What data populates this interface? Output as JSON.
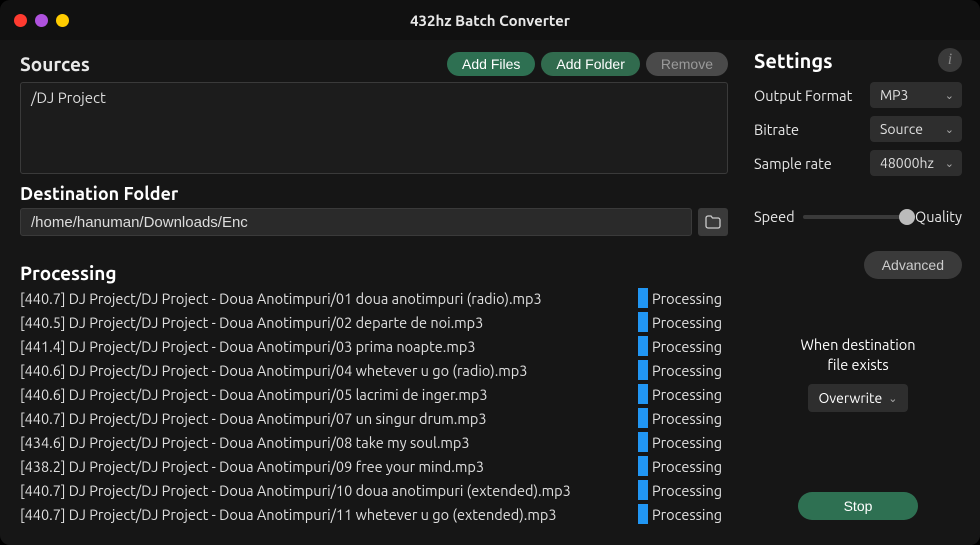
{
  "window": {
    "title": "432hz Batch Converter"
  },
  "sources": {
    "label": "Sources",
    "buttons": {
      "add_files": "Add Files",
      "add_folder": "Add Folder",
      "remove": "Remove"
    },
    "items": [
      "/DJ Project"
    ]
  },
  "destination": {
    "label": "Destination Folder",
    "path": "/home/hanuman/Downloads/Enc"
  },
  "processing": {
    "label": "Processing",
    "status_text": "Processing",
    "items": [
      {
        "hz": "440.7",
        "name": "DJ Project/DJ Project - Doua Anotimpuri/01 doua anotimpuri (radio).mp3"
      },
      {
        "hz": "440.5",
        "name": "DJ Project/DJ Project - Doua Anotimpuri/02 departe de noi.mp3"
      },
      {
        "hz": "441.4",
        "name": "DJ Project/DJ Project - Doua Anotimpuri/03 prima noapte.mp3"
      },
      {
        "hz": "440.6",
        "name": "DJ Project/DJ Project - Doua Anotimpuri/04 whetever u go (radio).mp3"
      },
      {
        "hz": "440.6",
        "name": "DJ Project/DJ Project - Doua Anotimpuri/05 lacrimi de inger.mp3"
      },
      {
        "hz": "440.7",
        "name": "DJ Project/DJ Project - Doua Anotimpuri/07 un singur drum.mp3"
      },
      {
        "hz": "434.6",
        "name": "DJ Project/DJ Project - Doua Anotimpuri/08 take my soul.mp3"
      },
      {
        "hz": "438.2",
        "name": "DJ Project/DJ Project - Doua Anotimpuri/09 free your mind.mp3"
      },
      {
        "hz": "440.7",
        "name": "DJ Project/DJ Project - Doua Anotimpuri/10 doua anotimpuri (extended).mp3"
      },
      {
        "hz": "440.7",
        "name": "DJ Project/DJ Project - Doua Anotimpuri/11 whetever u go (extended).mp3"
      }
    ]
  },
  "settings": {
    "title": "Settings",
    "output_format": {
      "label": "Output Format",
      "value": "MP3"
    },
    "bitrate": {
      "label": "Bitrate",
      "value": "Source"
    },
    "sample_rate": {
      "label": "Sample rate",
      "value": "48000hz"
    },
    "speed": {
      "label_left": "Speed",
      "label_right": "Quality"
    },
    "advanced": "Advanced",
    "dest_exists": {
      "line1": "When destination",
      "line2": "file exists",
      "value": "Overwrite"
    },
    "stop": "Stop"
  }
}
